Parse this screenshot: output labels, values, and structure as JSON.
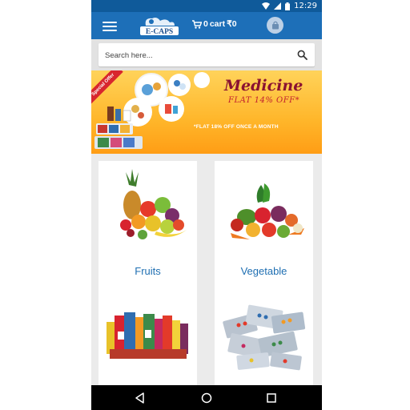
{
  "status_bar": {
    "time": "12:29"
  },
  "header": {
    "menu_icon": "hamburger-menu-icon",
    "logo_text": "E-CAPS",
    "cart_count": "0",
    "cart_label": "cart",
    "cart_total": "₹0",
    "bag_icon": "shopping-bag-icon"
  },
  "search": {
    "placeholder": "Search here..."
  },
  "banner": {
    "ribbon": "Special Offer",
    "title": "Medicine",
    "offer": "FLAT 14% OFF*",
    "sub": "*FLAT 18% OFF ONCE A MONTH"
  },
  "categories": [
    {
      "label": "Fruits"
    },
    {
      "label": "Vegetable"
    },
    {
      "label": ""
    },
    {
      "label": ""
    }
  ],
  "colors": {
    "appbar": "#1d6fb8",
    "statusbar": "#0f5a9a",
    "category_text": "#1f6fb2",
    "banner": "#ffb62a"
  }
}
